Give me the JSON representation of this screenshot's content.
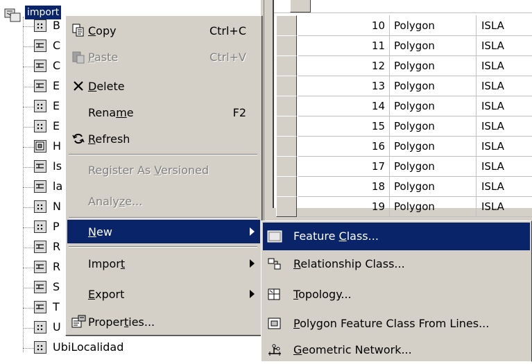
{
  "tree": {
    "root_label": "import",
    "items": [
      {
        "letter": "B",
        "icon": "polygon-featureclass-icon"
      },
      {
        "letter": "C",
        "icon": "line-featureclass-icon"
      },
      {
        "letter": "C",
        "icon": "line-featureclass-icon"
      },
      {
        "letter": "E",
        "icon": "line-featureclass-icon"
      },
      {
        "letter": "E",
        "icon": "polygon-featureclass-icon"
      },
      {
        "letter": "E",
        "icon": "polygon-featureclass-icon"
      },
      {
        "letter": "H",
        "icon": "polygon-from-lines-icon"
      },
      {
        "letter": "Is",
        "icon": "line-featureclass-icon"
      },
      {
        "letter": "la",
        "icon": "line-featureclass-icon"
      },
      {
        "letter": "N",
        "icon": "polygon-featureclass-icon"
      },
      {
        "letter": "P",
        "icon": "polygon-featureclass-icon"
      },
      {
        "letter": "R",
        "icon": "line-featureclass-icon"
      },
      {
        "letter": "R",
        "icon": "line-featureclass-icon"
      },
      {
        "letter": "S",
        "icon": "line-featureclass-icon"
      },
      {
        "letter": "T",
        "icon": "line-featureclass-icon"
      },
      {
        "letter": "U",
        "icon": "polygon-featureclass-icon"
      },
      {
        "letter": "UbiLocalidad",
        "icon": "polygon-featureclass-icon"
      }
    ]
  },
  "grid": {
    "rows": [
      {
        "id": "10",
        "shape": "Polygon",
        "zone": "ISLA"
      },
      {
        "id": "11",
        "shape": "Polygon",
        "zone": "ISLA"
      },
      {
        "id": "12",
        "shape": "Polygon",
        "zone": "ISLA"
      },
      {
        "id": "13",
        "shape": "Polygon",
        "zone": "ISLA"
      },
      {
        "id": "14",
        "shape": "Polygon",
        "zone": "ISLA"
      },
      {
        "id": "15",
        "shape": "Polygon",
        "zone": "ISLA"
      },
      {
        "id": "16",
        "shape": "Polygon",
        "zone": "ISLA"
      },
      {
        "id": "17",
        "shape": "Polygon",
        "zone": "ISLA"
      },
      {
        "id": "18",
        "shape": "Polygon",
        "zone": "ISLA"
      },
      {
        "id": "19",
        "shape": "Polygon",
        "zone": "ISLA"
      }
    ]
  },
  "menu": {
    "copy": {
      "pre": "",
      "key": "C",
      "post": "opy",
      "shortcut": "Ctrl+C",
      "icon": "copy-icon"
    },
    "paste": {
      "pre": "",
      "key": "P",
      "post": "aste",
      "shortcut": "Ctrl+V",
      "icon": "paste-icon"
    },
    "delete": {
      "pre": "",
      "key": "D",
      "post": "elete",
      "icon": "delete-x-icon"
    },
    "rename": {
      "pre": "Rena",
      "key": "m",
      "post": "e",
      "shortcut": "F2"
    },
    "refresh": {
      "pre": "",
      "key": "R",
      "post": "efresh",
      "icon": "refresh-icon"
    },
    "register": {
      "pre": "Register As ",
      "key": "V",
      "post": "ersioned"
    },
    "analyze": {
      "pre": "Analy",
      "key": "z",
      "post": "e..."
    },
    "new": {
      "pre": "",
      "key": "N",
      "post": "ew"
    },
    "import": {
      "pre": "Impor",
      "key": "t",
      "post": ""
    },
    "export": {
      "pre": "",
      "key": "E",
      "post": "xport"
    },
    "properties": {
      "pre": "Proper",
      "key": "t",
      "post": "ies...",
      "icon": "properties-icon"
    }
  },
  "submenu": {
    "feature_class": {
      "pre": "Feature ",
      "key": "C",
      "post": "lass...",
      "icon": "feature-class-icon"
    },
    "relationship_class": {
      "pre": "",
      "key": "R",
      "post": "elationship Class...",
      "icon": "relationship-class-icon"
    },
    "topology": {
      "pre": "",
      "key": "T",
      "post": "opology...",
      "icon": "topology-icon"
    },
    "polygon_from_lines": {
      "pre": "",
      "key": "P",
      "post": "olygon Feature Class From Lines...",
      "icon": "polygon-from-lines-icon"
    },
    "geometric_network": {
      "pre": "",
      "key": "G",
      "post": "eometric Network...",
      "icon": "geometric-network-icon"
    }
  }
}
